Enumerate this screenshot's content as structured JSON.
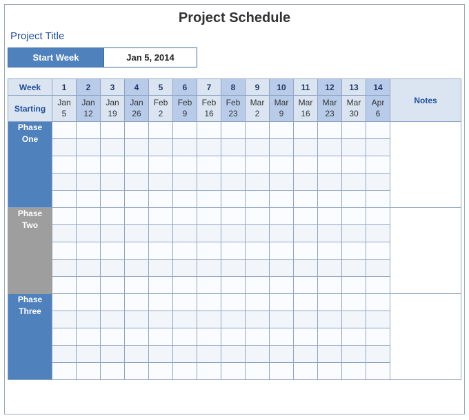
{
  "title": "Project Schedule",
  "projectTitleLabel": "Project Title",
  "startWeek": {
    "label": "Start Week",
    "value": "Jan 5, 2014"
  },
  "header": {
    "weekLabel": "Week",
    "startingLabel": "Starting",
    "notesLabel": "Notes"
  },
  "weeks": [
    {
      "num": "1",
      "month": "Jan",
      "day": "5",
      "hl": false
    },
    {
      "num": "2",
      "month": "Jan",
      "day": "12",
      "hl": true
    },
    {
      "num": "3",
      "month": "Jan",
      "day": "19",
      "hl": false
    },
    {
      "num": "4",
      "month": "Jan",
      "day": "26",
      "hl": true
    },
    {
      "num": "5",
      "month": "Feb",
      "day": "2",
      "hl": false
    },
    {
      "num": "6",
      "month": "Feb",
      "day": "9",
      "hl": true
    },
    {
      "num": "7",
      "month": "Feb",
      "day": "16",
      "hl": false
    },
    {
      "num": "8",
      "month": "Feb",
      "day": "23",
      "hl": true
    },
    {
      "num": "9",
      "month": "Mar",
      "day": "2",
      "hl": false
    },
    {
      "num": "10",
      "month": "Mar",
      "day": "9",
      "hl": true
    },
    {
      "num": "11",
      "month": "Mar",
      "day": "16",
      "hl": false
    },
    {
      "num": "12",
      "month": "Mar",
      "day": "23",
      "hl": true
    },
    {
      "num": "13",
      "month": "Mar",
      "day": "30",
      "hl": false
    },
    {
      "num": "14",
      "month": "Apr",
      "day": "6",
      "hl": true
    }
  ],
  "phases": [
    {
      "name": "Phase One",
      "style": "blue",
      "rows": 5
    },
    {
      "name": "Phase Two",
      "style": "grey",
      "rows": 5
    },
    {
      "name": "Phase Three",
      "style": "blue",
      "rows": 5
    }
  ]
}
